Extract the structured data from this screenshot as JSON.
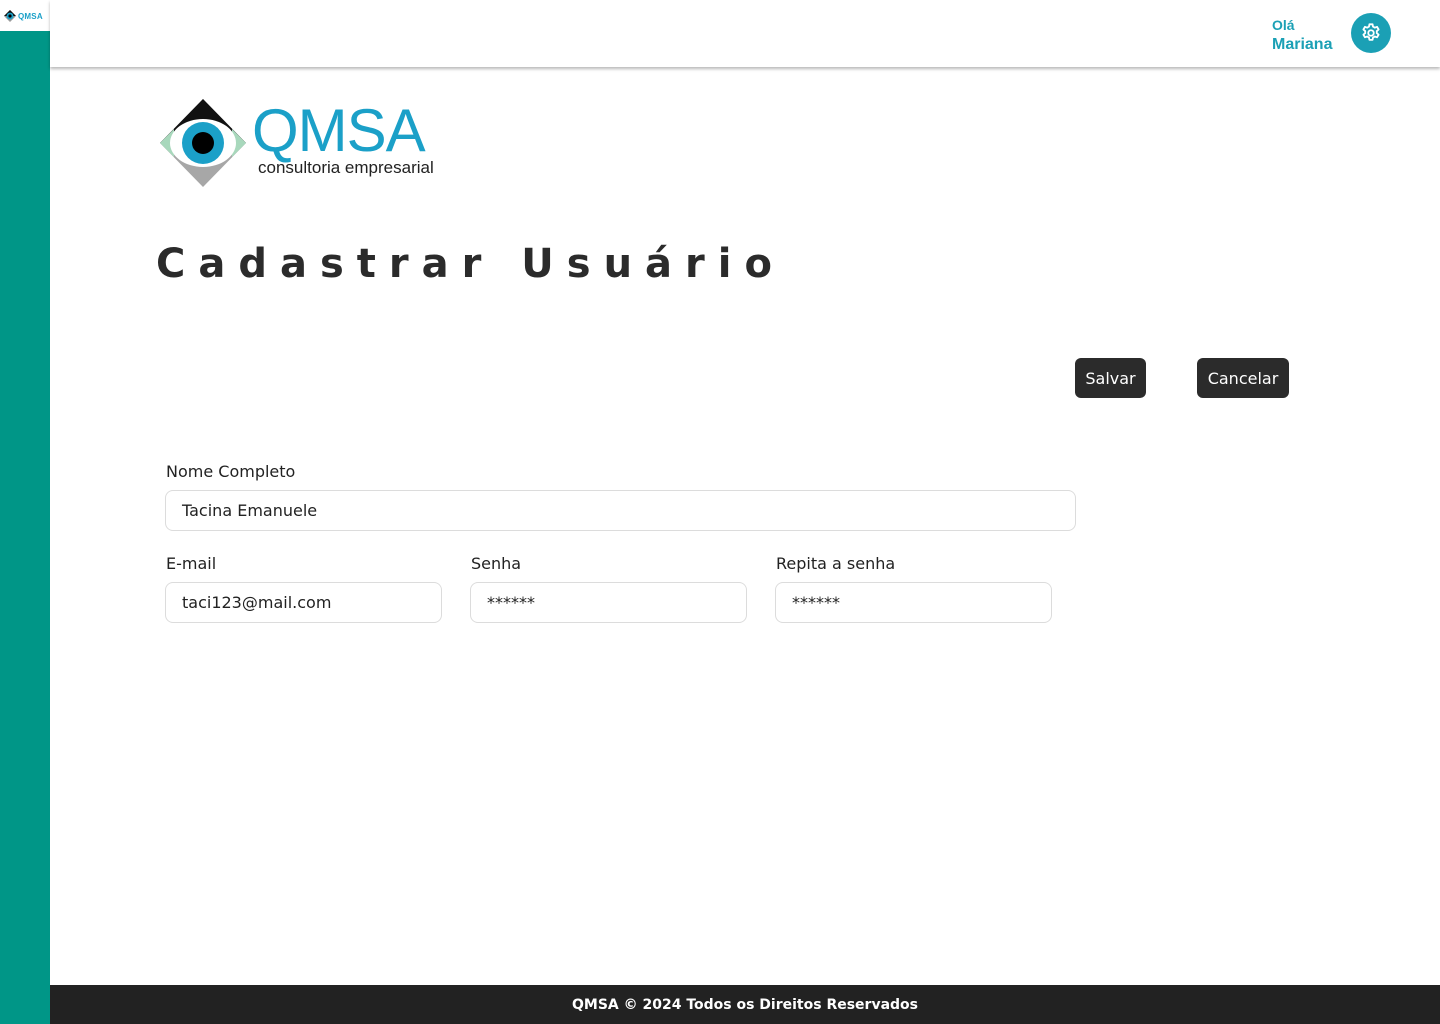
{
  "sidebar": {
    "logo_text": "QMSA",
    "accent": "#009687"
  },
  "header": {
    "greeting": "Olá",
    "username": "Mariana",
    "settings_icon": "gear-icon",
    "accent": "#1ba0b5"
  },
  "brand": {
    "name": "QMSA",
    "tagline": "consultoria empresarial"
  },
  "page": {
    "title": "Cadastrar Usuário"
  },
  "actions": {
    "save_label": "Salvar",
    "cancel_label": "Cancelar"
  },
  "form": {
    "full_name": {
      "label": "Nome Completo",
      "value": "Tacina Emanuele"
    },
    "email": {
      "label": "E-mail",
      "value": "taci123@mail.com"
    },
    "password": {
      "label": "Senha",
      "value": "******"
    },
    "repeat_password": {
      "label": "Repita a senha",
      "value": "******"
    }
  },
  "footer": {
    "text": "QMSA © 2024 Todos os Direitos Reservados"
  }
}
